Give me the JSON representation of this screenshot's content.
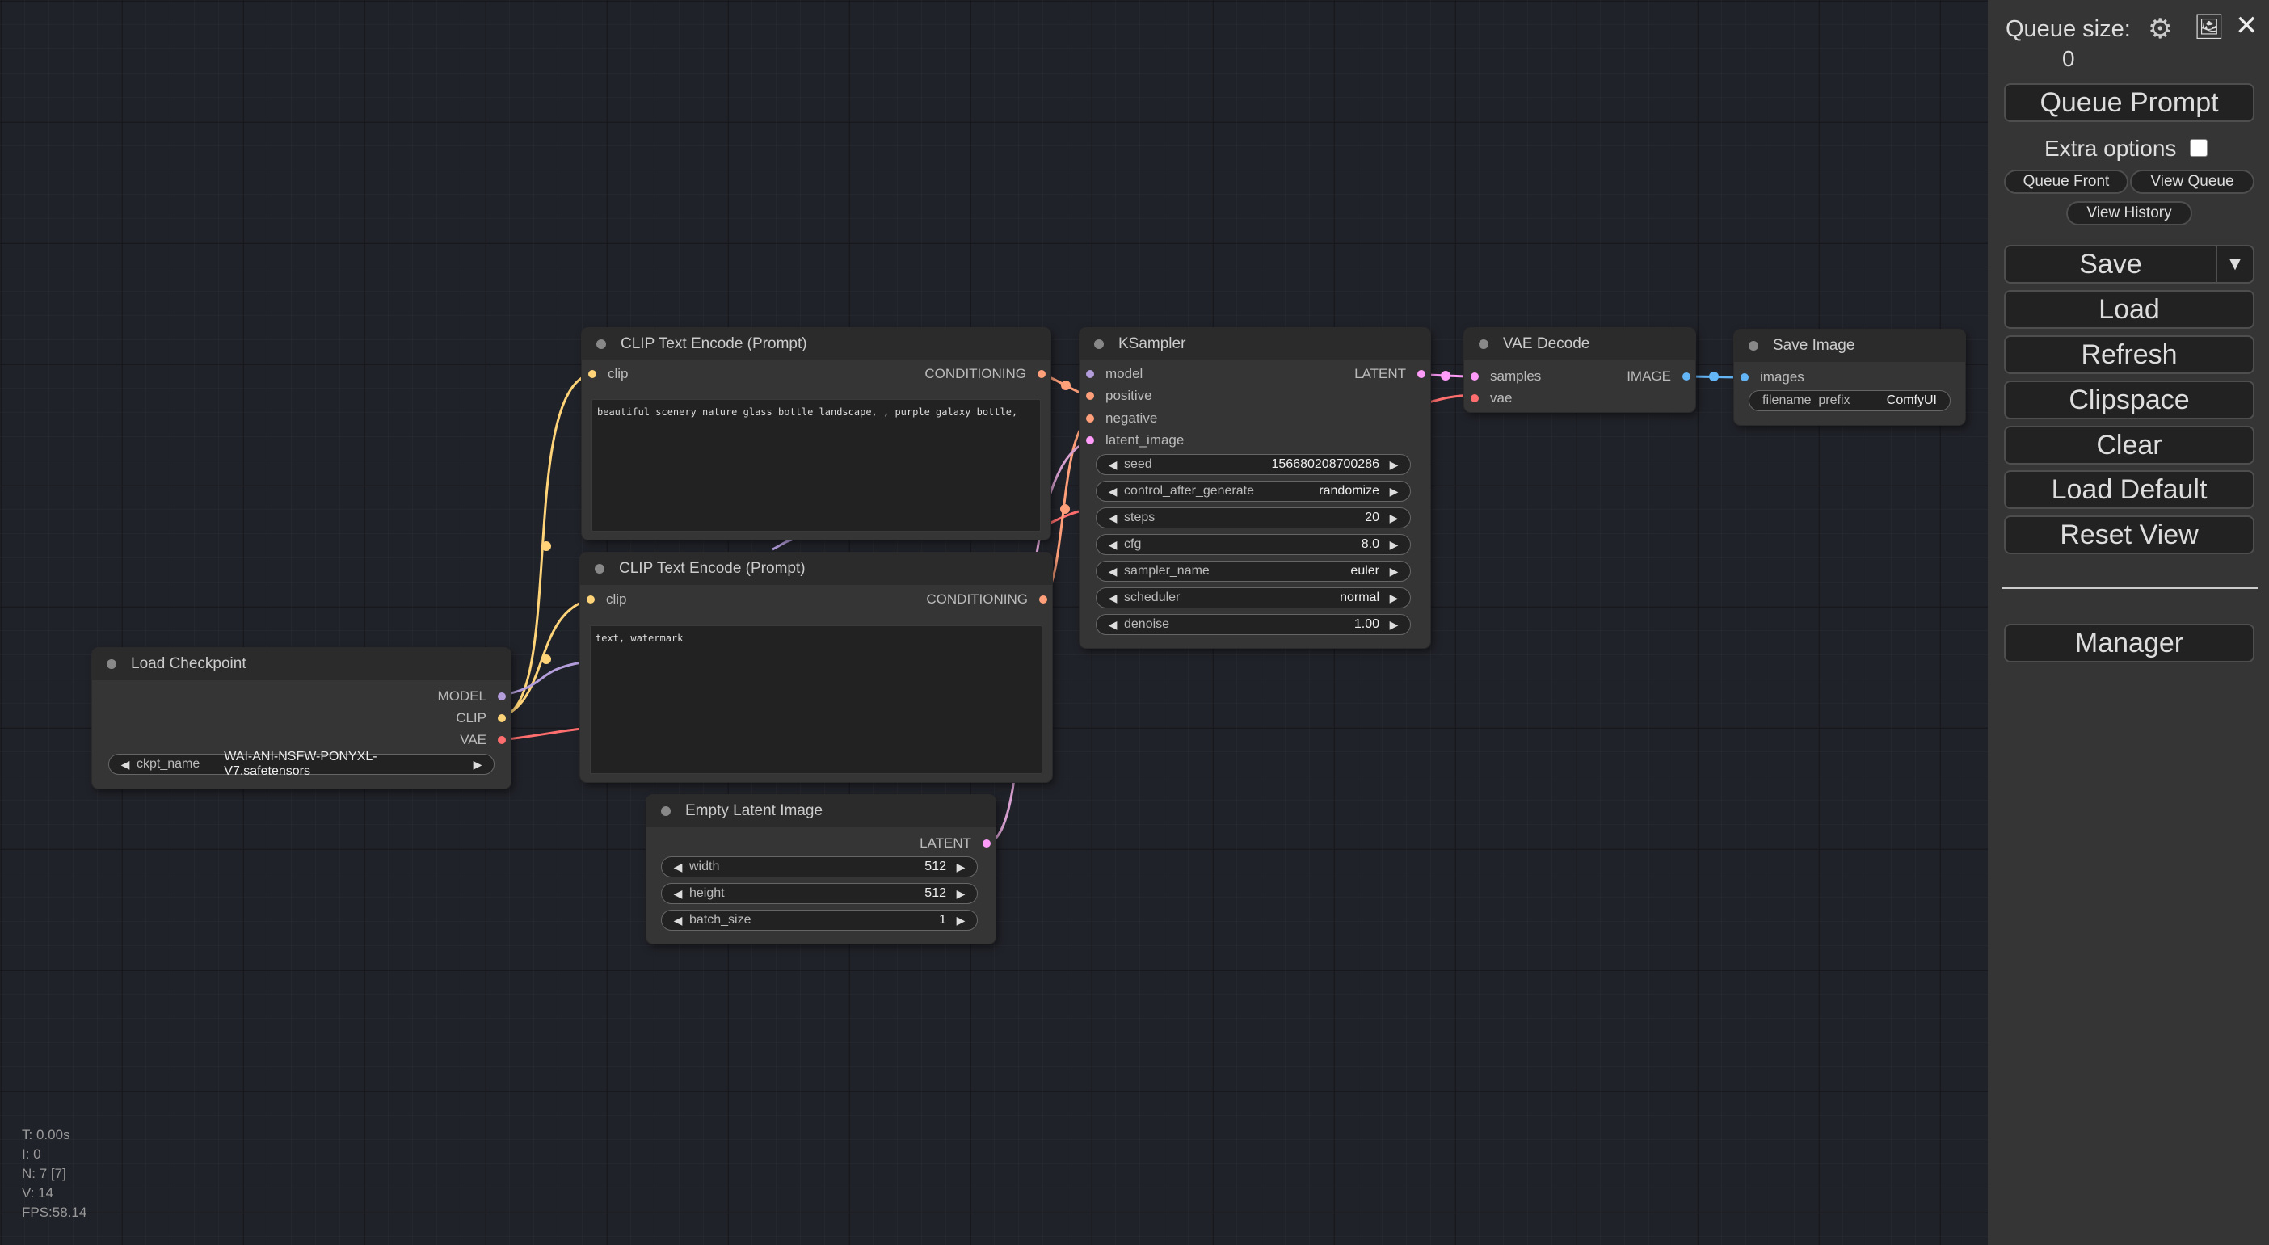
{
  "menu": {
    "queue_size_label": "Queue size:",
    "queue_size_value": "0",
    "gear_icon": "⚙",
    "image_icon": "🖼",
    "close_icon": "✕",
    "queue_prompt": "Queue Prompt",
    "extra_options": "Extra options",
    "queue_front": "Queue Front",
    "view_queue": "View Queue",
    "view_history": "View History",
    "save": "Save",
    "save_dropdown": "▼",
    "load": "Load",
    "refresh": "Refresh",
    "clipspace": "Clipspace",
    "clear": "Clear",
    "load_default": "Load Default",
    "reset_view": "Reset View",
    "manager": "Manager"
  },
  "stats": {
    "t": "T: 0.00s",
    "i": "I: 0",
    "n": "N: 7 [7]",
    "v": "V: 14",
    "fps": "FPS:58.14"
  },
  "nodes": {
    "clip1": {
      "title": "CLIP Text Encode (Prompt)",
      "input_clip": "clip",
      "output": "CONDITIONING",
      "text": "beautiful scenery nature glass bottle landscape, , purple galaxy bottle,"
    },
    "clip2": {
      "title": "CLIP Text Encode (Prompt)",
      "input_clip": "clip",
      "output": "CONDITIONING",
      "text": "text, watermark"
    },
    "ksampler": {
      "title": "KSampler",
      "inputs": [
        "model",
        "positive",
        "negative",
        "latent_image"
      ],
      "output": "LATENT",
      "widgets": [
        {
          "name": "seed",
          "value": "156680208700286"
        },
        {
          "name": "control_after_generate",
          "value": "randomize"
        },
        {
          "name": "steps",
          "value": "20"
        },
        {
          "name": "cfg",
          "value": "8.0"
        },
        {
          "name": "sampler_name",
          "value": "euler"
        },
        {
          "name": "scheduler",
          "value": "normal"
        },
        {
          "name": "denoise",
          "value": "1.00"
        }
      ]
    },
    "vae_decode": {
      "title": "VAE Decode",
      "inputs": [
        "samples",
        "vae"
      ],
      "output": "IMAGE"
    },
    "save_image": {
      "title": "Save Image",
      "input": "images",
      "widget": {
        "name": "filename_prefix",
        "value": "ComfyUI"
      }
    },
    "load_checkpoint": {
      "title": "Load Checkpoint",
      "outputs": [
        "MODEL",
        "CLIP",
        "VAE"
      ],
      "widget": {
        "name": "ckpt_name",
        "value": "WAI-ANI-NSFW-PONYXL-V7.safetensors"
      }
    },
    "empty_latent": {
      "title": "Empty Latent Image",
      "output": "LATENT",
      "widgets": [
        {
          "name": "width",
          "value": "512"
        },
        {
          "name": "height",
          "value": "512"
        },
        {
          "name": "batch_size",
          "value": "1"
        }
      ]
    }
  },
  "colors": {
    "model": "#b39ddb",
    "clip": "#ffd479",
    "vae": "#ff6e6e",
    "conditioning": "#ffa07a",
    "latent": "#ff9cf9",
    "image": "#64b5f6"
  }
}
